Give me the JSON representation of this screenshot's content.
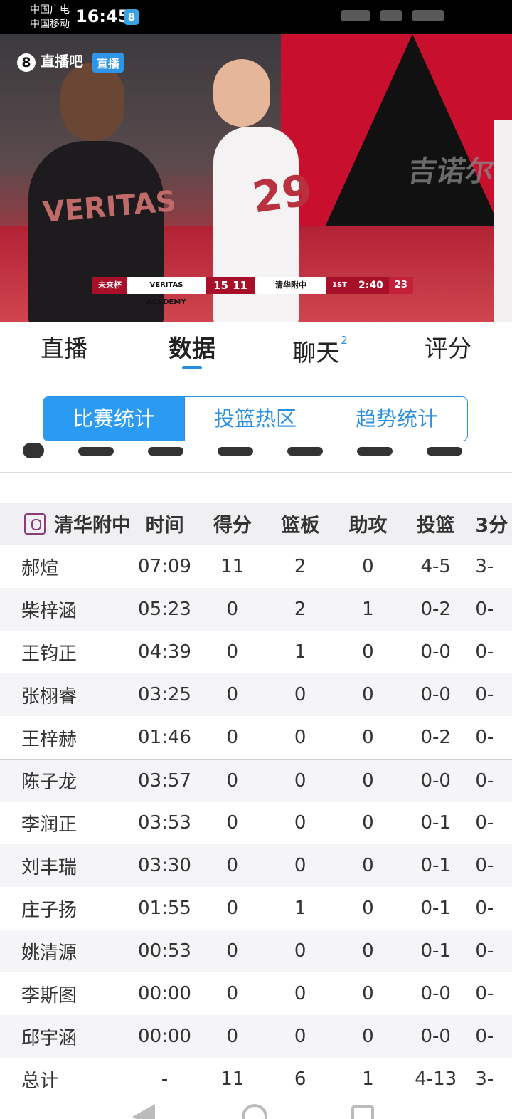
{
  "status_bar": {
    "carrier1": "中国广电",
    "carrier2": "中国移动",
    "time": "16:45",
    "app_badge": "8"
  },
  "video": {
    "watermark_logo": "8",
    "watermark_brand": "直播吧",
    "watermark_tag": "直播",
    "sponsor_text": "吉诺尔",
    "player1_jersey": "VERITAS",
    "player2_number": "29",
    "scorebug": {
      "cup": "未来杯",
      "team_a": "VERITAS ACADEMY",
      "score_a": "15",
      "score_b": "11",
      "team_b": "清华附中",
      "quarter": "1ST",
      "clock": "2:40",
      "shot_clock": "23"
    }
  },
  "tabs": [
    {
      "label": "直播",
      "badge": ""
    },
    {
      "label": "数据",
      "badge": ""
    },
    {
      "label": "聊天",
      "badge": "2"
    },
    {
      "label": "评分",
      "badge": ""
    }
  ],
  "segments": [
    "比赛统计",
    "投篮热区",
    "趋势统计"
  ],
  "table": {
    "team": "清华附中",
    "headers": [
      "时间",
      "得分",
      "篮板",
      "助攻",
      "投篮",
      "3分"
    ],
    "rows": [
      [
        "郝煊",
        "07:09",
        "11",
        "2",
        "0",
        "4-5",
        "3-"
      ],
      [
        "柴梓涵",
        "05:23",
        "0",
        "2",
        "1",
        "0-2",
        "0-"
      ],
      [
        "王钧正",
        "04:39",
        "0",
        "1",
        "0",
        "0-0",
        "0-"
      ],
      [
        "张栩睿",
        "03:25",
        "0",
        "0",
        "0",
        "0-0",
        "0-"
      ],
      [
        "王梓赫",
        "01:46",
        "0",
        "0",
        "0",
        "0-2",
        "0-"
      ],
      [
        "陈子龙",
        "03:57",
        "0",
        "0",
        "0",
        "0-0",
        "0-"
      ],
      [
        "李润正",
        "03:53",
        "0",
        "0",
        "0",
        "0-1",
        "0-"
      ],
      [
        "刘丰瑞",
        "03:30",
        "0",
        "0",
        "0",
        "0-1",
        "0-"
      ],
      [
        "庄子扬",
        "01:55",
        "0",
        "1",
        "0",
        "0-1",
        "0-"
      ],
      [
        "姚清源",
        "00:53",
        "0",
        "0",
        "0",
        "0-1",
        "0-"
      ],
      [
        "李斯图",
        "00:00",
        "0",
        "0",
        "0",
        "0-0",
        "0-"
      ],
      [
        "邱宇涵",
        "00:00",
        "0",
        "0",
        "0",
        "0-0",
        "0-"
      ],
      [
        "总计",
        "-",
        "11",
        "6",
        "1",
        "4-13",
        "3-"
      ]
    ]
  },
  "colors": {
    "accent": "#2b8fe0",
    "scorebug_red": "#a8102a"
  }
}
